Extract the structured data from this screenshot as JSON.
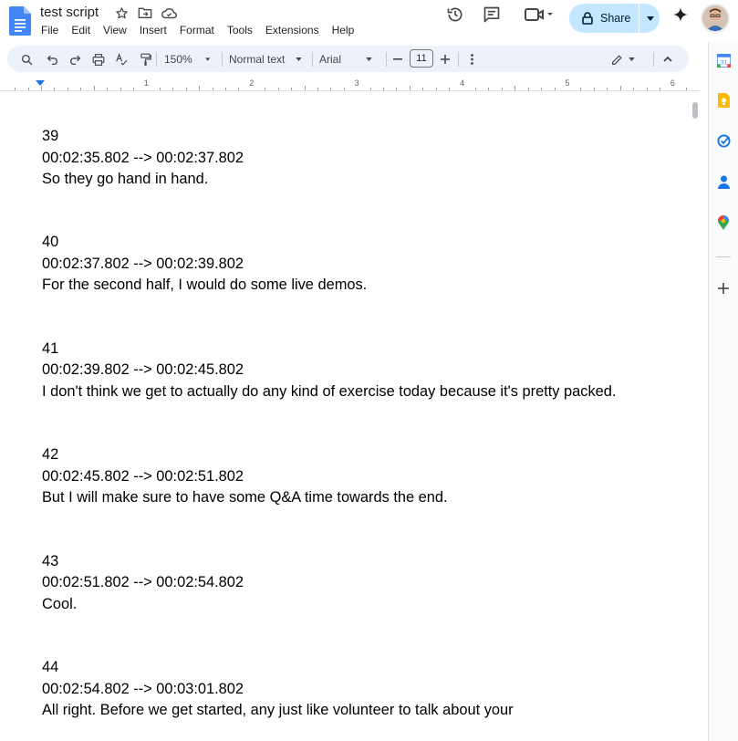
{
  "document": {
    "title": "test script",
    "menus": [
      "File",
      "Edit",
      "View",
      "Insert",
      "Format",
      "Tools",
      "Extensions",
      "Help"
    ]
  },
  "header": {
    "share_label": "Share"
  },
  "toolbar": {
    "zoom": "150%",
    "style": "Normal text",
    "font": "Arial",
    "font_size": "11"
  },
  "ruler": {
    "labels": [
      "1",
      "2",
      "3",
      "4",
      "5",
      "6"
    ]
  },
  "entries": [
    {
      "index": "39",
      "timestamp": "00:02:35.802 --> 00:02:37.802",
      "text": "So they go hand in hand."
    },
    {
      "index": "40",
      "timestamp": "00:02:37.802 --> 00:02:39.802",
      "text": "For the second half, I would do some live demos."
    },
    {
      "index": "41",
      "timestamp": "00:02:39.802 --> 00:02:45.802",
      "text": "I don't think we get to actually do any kind of exercise today because it's pretty packed."
    },
    {
      "index": "42",
      "timestamp": "00:02:45.802 --> 00:02:51.802",
      "text": "But I will make sure to have some Q&A time towards the end."
    },
    {
      "index": "43",
      "timestamp": "00:02:51.802 --> 00:02:54.802",
      "text": "Cool."
    },
    {
      "index": "44",
      "timestamp": "00:02:54.802 --> 00:03:01.802",
      "text": "All right. Before we get started, any just like volunteer to talk about your"
    }
  ],
  "colors": {
    "share_bg": "#c2e7ff",
    "toolbar_bg": "#edf2fa",
    "docs_blue": "#4285f4",
    "ruler_marker": "#1a73e8"
  },
  "icons": {
    "title": [
      "star-icon",
      "move-to-folder-icon",
      "cloud-saved-icon"
    ],
    "header": [
      "version-history-icon",
      "comments-icon",
      "meet-icon",
      "gemini-icon"
    ],
    "side": [
      "calendar-icon",
      "keep-icon",
      "tasks-icon",
      "contacts-icon",
      "maps-icon",
      "add-icon"
    ]
  }
}
